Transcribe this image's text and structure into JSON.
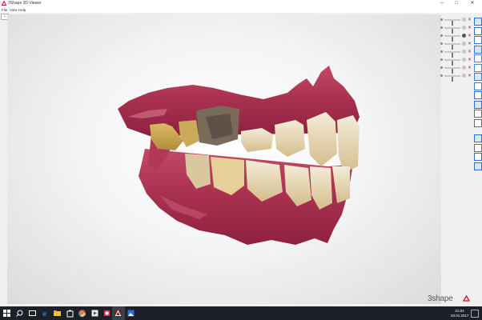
{
  "window": {
    "title": "3Shape 3D Viewer",
    "controls": [
      "–",
      "□",
      "✕"
    ]
  },
  "menu": [
    {
      "label": "File"
    },
    {
      "label": "View"
    },
    {
      "label": "Help"
    }
  ],
  "viewer": {
    "back_label": "‹",
    "brand_name": "3shape",
    "brand_color": "#c8102e"
  },
  "layers": [
    {
      "level": 0.5,
      "eye": "grey"
    },
    {
      "level": 0.5,
      "eye": "grey"
    },
    {
      "level": 0.5,
      "eye": "dark"
    },
    {
      "level": 0.5,
      "eye": "grey"
    },
    {
      "level": 0.5,
      "eye": "grey"
    },
    {
      "level": 0.5,
      "eye": "grey"
    },
    {
      "level": 0.5,
      "eye": "grey"
    },
    {
      "level": 0.5,
      "eye": "grey"
    }
  ],
  "toolbar_icons": [
    "measure-icon",
    "cube-icon",
    "view-front-icon",
    "view-back-icon",
    "view-left-icon",
    "view-right-icon",
    "view-top-icon",
    "view-bottom-icon",
    "zoom-in-icon",
    "zoom-out-icon",
    "pan-icon",
    "rotate-icon",
    "section-icon",
    "snapshot-icon",
    "ruler-icon",
    "check-icon"
  ],
  "taskbar": {
    "apps": [
      "start-icon",
      "search-icon",
      "task-view-icon",
      "edge-icon",
      "file-explorer-icon",
      "store-icon",
      "chrome-icon",
      "media-player-icon",
      "app-icon",
      "viewer-app-icon",
      "red-app-icon",
      "photos-icon"
    ],
    "time": "21:04",
    "date": "03.01.2017"
  }
}
